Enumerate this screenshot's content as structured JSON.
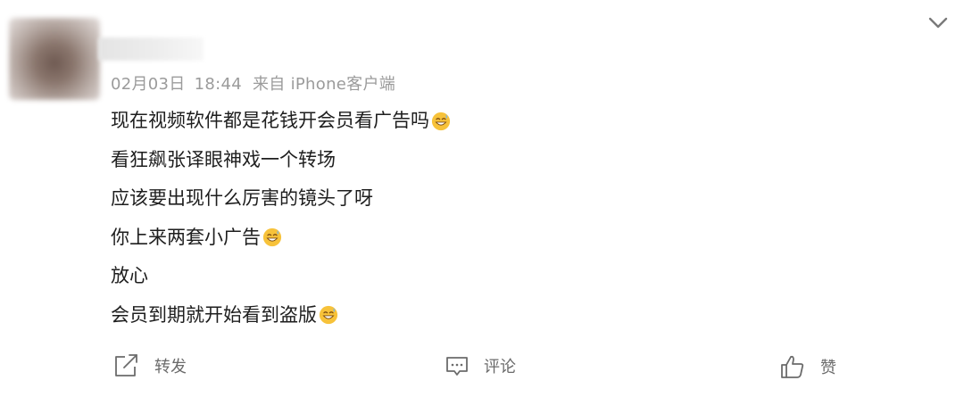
{
  "post": {
    "meta": {
      "date": "02月03日",
      "time": "18:44",
      "source": "来自 iPhone客户端"
    },
    "lines": [
      {
        "text": "现在视频软件都是花钱开会员看广告吗",
        "emoji": "sweat-smile-emoji"
      },
      {
        "text": "看狂飙张译眼神戏一个转场",
        "emoji": null
      },
      {
        "text": "应该要出现什么厉害的镜头了呀",
        "emoji": null
      },
      {
        "text": "你上来两套小广告",
        "emoji": "sweat-smile-emoji"
      },
      {
        "text": "放心",
        "emoji": null
      },
      {
        "text": "会员到期就开始看到盗版",
        "emoji": "sweat-smile-emoji"
      }
    ]
  },
  "actions": {
    "repost_label": "转发",
    "comment_label": "评论",
    "like_label": "赞"
  },
  "icons": {
    "expand": "chevron-down-icon",
    "repost": "share-icon",
    "comment": "comment-icon",
    "like": "thumbs-up-icon"
  },
  "colors": {
    "text": "#1e1e1e",
    "meta": "#9b9b9b",
    "action": "#6b6b6b",
    "emoji_face": "#f7c23a"
  }
}
